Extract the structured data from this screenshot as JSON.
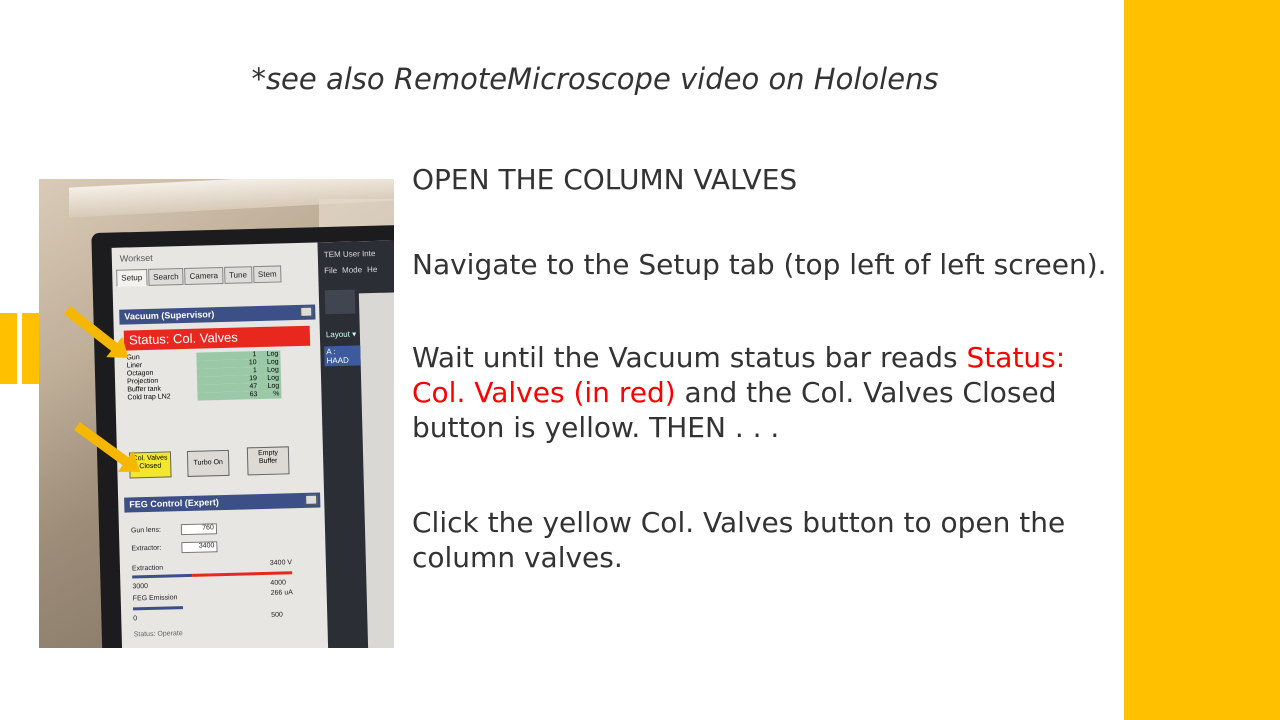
{
  "slide": {
    "subtitle": "*see also RemoteMicroscope video on Hololens",
    "heading": "OPEN THE COLUMN VALVES",
    "para2": "Navigate to the Setup tab (top left of left screen).",
    "para3_before": "Wait until the Vacuum status bar reads ",
    "para3_red": "Status: Col. Valves (in red)",
    "para3_after": " and the Col. Valves Closed button is yellow. THEN . . .",
    "para4": "Click the yellow Col. Valves button to open the column valves."
  },
  "colors": {
    "accent": "#FFC000",
    "status_red": "#FF0000",
    "text": "#333333"
  },
  "screenshot": {
    "workset_title": "Workset",
    "tabs": [
      "Setup",
      "Search",
      "Camera",
      "Tune",
      "Stem"
    ],
    "vacuum_header": "Vacuum (Supervisor)",
    "status_text": "Status: Col. Valves",
    "vacuum_rows": [
      {
        "label": "Gun",
        "value": "1",
        "unit": "Log"
      },
      {
        "label": "Liner",
        "value": "10",
        "unit": "Log"
      },
      {
        "label": "Octagon",
        "value": "1",
        "unit": "Log"
      },
      {
        "label": "Projection",
        "value": "19",
        "unit": "Log"
      },
      {
        "label": "Buffer tank",
        "value": "47",
        "unit": "Log"
      },
      {
        "label": "Cold trap LN2",
        "value": "63",
        "unit": "%"
      }
    ],
    "btn_col_valves_line1": "Col. Valves",
    "btn_col_valves_line2": "Closed",
    "btn_turbo": "Turbo On",
    "btn_empty_line1": "Empty",
    "btn_empty_line2": "Buffer",
    "feg_header": "FEG Control (Expert)",
    "gun_lens_label": "Gun lens:",
    "gun_lens_value": "760",
    "extractor_label": "Extractor:",
    "extractor_value": "3400",
    "extraction_label": "Extraction",
    "extraction_value": "3400",
    "extraction_unit": "V",
    "scale_min1": "3000",
    "scale_max1": "4000",
    "emission_label": "FEG Emission",
    "emission_value": "266",
    "emission_unit": "uA",
    "scale_min2": "0",
    "scale_max2": "500",
    "status_operate": "Status: Operate",
    "tem_title": "TEM User Inte",
    "menu_file": "File",
    "menu_mode": "Mode",
    "menu_help": "He",
    "layout_label": "Layout ▾",
    "haad_label": "A : HAAD"
  }
}
